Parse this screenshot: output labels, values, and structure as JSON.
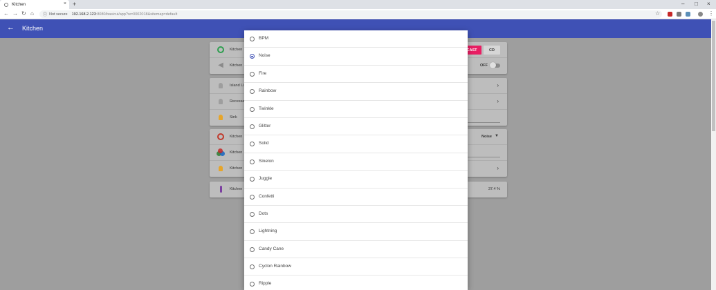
{
  "browser": {
    "tab_title": "Kitchen",
    "url_info": "Not secure",
    "url_host": "192.168.2.123",
    "url_path": ":8080/basicui/app?w=0002018&sitemap=default"
  },
  "app": {
    "title": "Kitchen",
    "header_color": "#3f51b5",
    "accent": "#e91e63"
  },
  "cards": {
    "c1": [
      {
        "label": "Kitchen",
        "icon": "power-icon",
        "cast_label": "CAST",
        "cd_label": "CD"
      },
      {
        "label": "Kitchen",
        "icon": "speaker-icon",
        "switch_label": "OFF"
      }
    ],
    "c2": [
      {
        "label": "Island Li",
        "icon": "bulb-icon"
      },
      {
        "label": "Recesse",
        "icon": "bulb-icon"
      },
      {
        "label": "Sink",
        "icon": "bulb-icon"
      }
    ],
    "c3": [
      {
        "label": "Kitchen",
        "icon": "power-icon",
        "value": "Noise"
      },
      {
        "label": "Kitchen",
        "icon": "color-wheel-icon"
      },
      {
        "label": "Kitchen",
        "icon": "bulb-icon"
      }
    ],
    "c4": [
      {
        "label": "Kitchen",
        "icon": "thermometer-icon",
        "value": "37.4 %"
      }
    ]
  },
  "dialog": {
    "selected": "Noise",
    "options": [
      "BPM",
      "Noise",
      "Fire",
      "Rainbow",
      "Twinkle",
      "Glitter",
      "Solid",
      "Sinelon",
      "Juggle",
      "Confetti",
      "Dots",
      "Lightning",
      "Candy Cane",
      "Cyclon Rainbow",
      "Ripple"
    ]
  }
}
